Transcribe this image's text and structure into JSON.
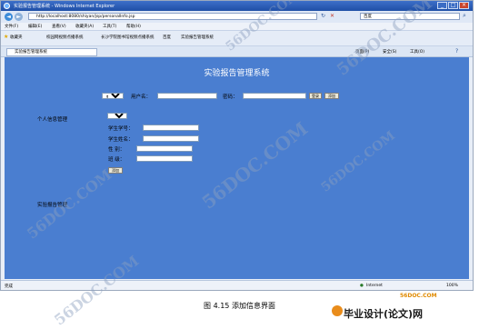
{
  "window": {
    "title": "实验报告管理系统 - Windows Internet Explorer",
    "minimize": "_",
    "maximize": "□",
    "close": "×"
  },
  "address_bar": {
    "back": "◄",
    "forward": "►",
    "url": "http://localhost:8080/shiyan/jsp/personalInfo.jsp",
    "search_placeholder": "百度"
  },
  "menu": [
    "文件(F)",
    "编辑(E)",
    "查看(V)",
    "收藏夹(A)",
    "工具(T)",
    "帮助(H)"
  ],
  "favorites": {
    "star_label": "收藏夹",
    "links": [
      "校园网视频点播系统",
      "长沙学院图书馆视频点播系统",
      "百度",
      "实验报告管理系统"
    ],
    "right_tools": [
      "页面(P)",
      "安全(S)",
      "工具(O)"
    ]
  },
  "tab": {
    "label": "实验报告管理系统"
  },
  "page": {
    "title": "实验报告管理系统",
    "search": {
      "role_select": "教师",
      "username_label": "用户名：",
      "password_label": "密码：",
      "login_button": "登录",
      "add_button": "添加"
    },
    "personal_info_label": "个人信息管理",
    "personal_form": {
      "type_select": "学生",
      "student_id_label": "学生学号：",
      "student_name_label": "学生姓名：",
      "gender_label": "性    别：",
      "class_label": "班    级：",
      "add_button": "添加"
    },
    "report_label": "实验报告管理"
  },
  "status": {
    "left": "完成",
    "zone": "Internet",
    "zoom": "100%"
  },
  "caption": "图 4.15  添加信息界面",
  "watermark": "56DOC.COM",
  "brand": {
    "site": "56DOC.COM",
    "name": "毕业设计(论文)网"
  },
  "colors": {
    "page_bg": "#4a7ed0",
    "title_bar": "#1f4fa6"
  }
}
